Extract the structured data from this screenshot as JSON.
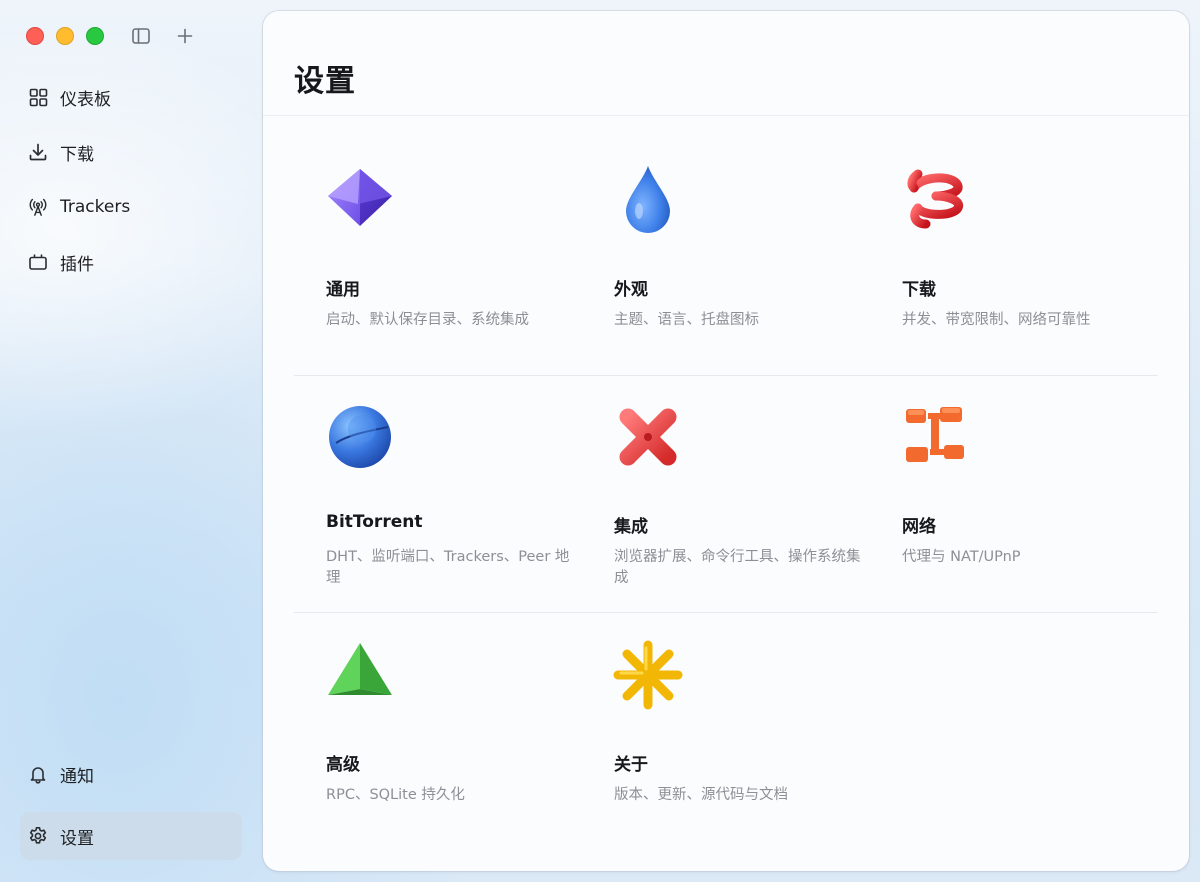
{
  "window": {
    "controls": [
      "close",
      "minimize",
      "maximize"
    ],
    "toolbar_icons": [
      "sidebar-toggle-icon",
      "plus-icon"
    ]
  },
  "sidebar": {
    "items": [
      {
        "label": "仪表板",
        "icon": "dashboard-grid-icon"
      },
      {
        "label": "下载",
        "icon": "download-icon"
      },
      {
        "label": "Trackers",
        "icon": "antenna-icon"
      },
      {
        "label": "插件",
        "icon": "plugin-icon"
      }
    ],
    "bottom_items": [
      {
        "label": "通知",
        "icon": "bell-icon"
      },
      {
        "label": "设置",
        "icon": "gear-icon",
        "active": true
      }
    ]
  },
  "main": {
    "title": "设置",
    "cards": [
      {
        "title": "通用",
        "desc": "启动、默认保存目录、系统集成",
        "icon": "purple-octahedron-icon"
      },
      {
        "title": "外观",
        "desc": "主题、语言、托盘图标",
        "icon": "blue-drop-icon"
      },
      {
        "title": "下载",
        "desc": "并发、带宽限制、网络可靠性",
        "icon": "red-coil-icon"
      },
      {
        "title": "BitTorrent",
        "desc": "DHT、监听端口、Trackers、Peer 地理",
        "icon": "blue-sphere-icon"
      },
      {
        "title": "集成",
        "desc": "浏览器扩展、命令行工具、操作系统集成",
        "icon": "red-cross-icon"
      },
      {
        "title": "网络",
        "desc": "代理与 NAT/UPnP",
        "icon": "orange-network-icon"
      },
      {
        "title": "高级",
        "desc": "RPC、SQLite 持久化",
        "icon": "green-pyramid-icon"
      },
      {
        "title": "关于",
        "desc": "版本、更新、源代码与文档",
        "icon": "yellow-star-icon"
      }
    ]
  },
  "colors": {
    "accent_active_bg": "#cddae8",
    "close": "#fe5f57",
    "minimize": "#febc2e",
    "maximize": "#28c840"
  }
}
